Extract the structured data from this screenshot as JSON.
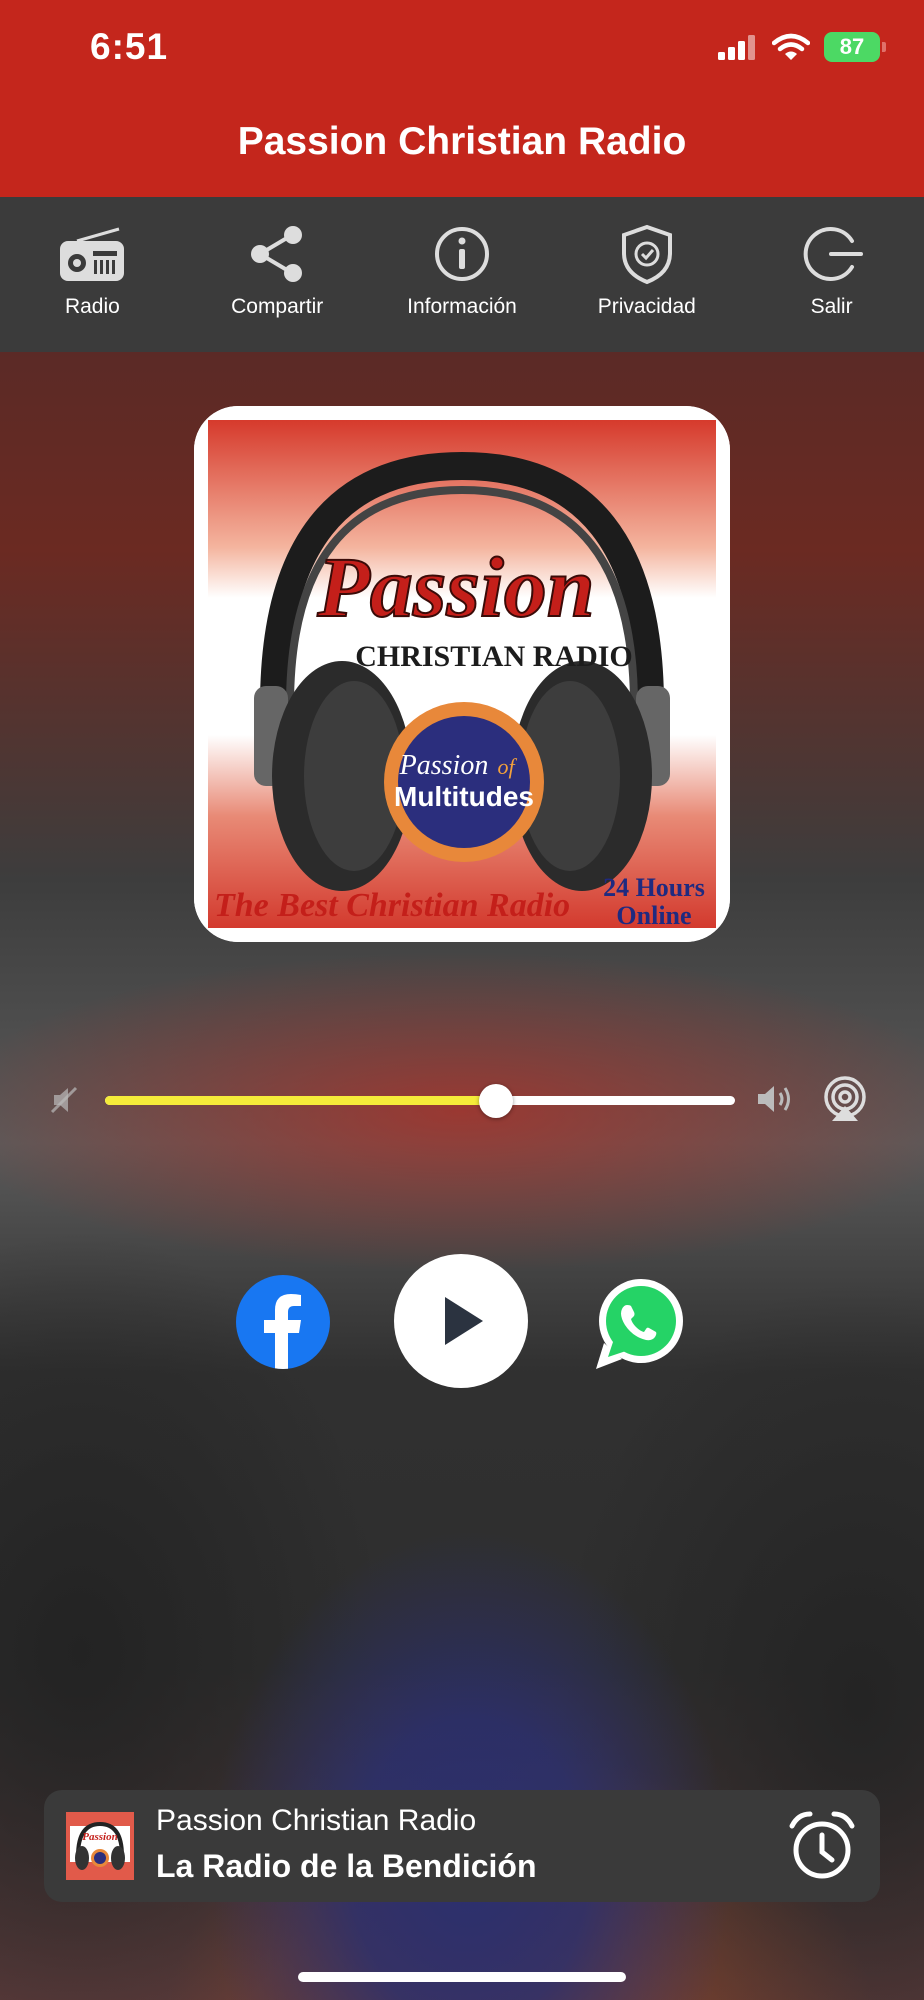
{
  "status_bar": {
    "time": "6:51",
    "battery": "87"
  },
  "header": {
    "title": "Passion Christian Radio"
  },
  "toolbar": {
    "items": [
      {
        "label": "Radio",
        "icon": "radio-icon"
      },
      {
        "label": "Compartir",
        "icon": "share-icon"
      },
      {
        "label": "Información",
        "icon": "info-icon"
      },
      {
        "label": "Privacidad",
        "icon": "shield-check-icon"
      },
      {
        "label": "Salir",
        "icon": "power-icon"
      }
    ]
  },
  "album_art": {
    "title": "Passion",
    "subtitle": "CHRISTIAN RADIO",
    "badge_line1": "Passion",
    "badge_of": "of",
    "badge_line2": "Multitudes",
    "slogan": "The Best Christian Radio",
    "hours_line1": "24 Hours",
    "hours_line2": "Online"
  },
  "volume": {
    "level": 0.62
  },
  "now_playing": {
    "station": "Passion Christian Radio",
    "track": "La Radio de la Bendición"
  },
  "colors": {
    "header_red": "#c4261c",
    "toolbar_gray": "#3b3b3b",
    "volume_fill": "#f5ec3a",
    "facebook_blue": "#1877f2",
    "whatsapp_green": "#25d366"
  }
}
